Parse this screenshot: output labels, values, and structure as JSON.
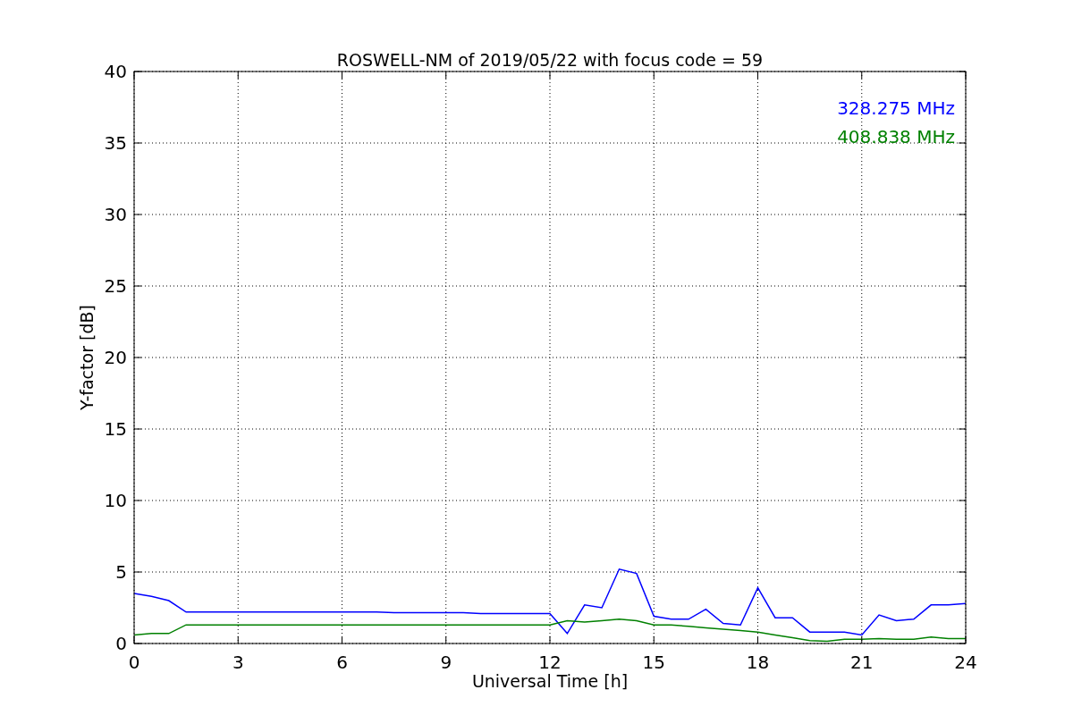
{
  "chart_data": {
    "type": "line",
    "title": "ROSWELL-NM of 2019/05/22 with focus code = 59",
    "xlabel": "Universal Time [h]",
    "ylabel": "Y-factor [dB]",
    "x": [
      0,
      0.5,
      1,
      1.5,
      2,
      2.5,
      3,
      3.5,
      4,
      4.5,
      5,
      5.5,
      6,
      6.5,
      7,
      7.5,
      8,
      8.5,
      9,
      9.5,
      10,
      10.5,
      11,
      11.5,
      12,
      12.5,
      13,
      13.5,
      14,
      14.5,
      15,
      15.5,
      16,
      16.5,
      17,
      17.5,
      18,
      18.5,
      19,
      19.5,
      20,
      20.5,
      21,
      21.5,
      22,
      22.5,
      23,
      23.5,
      24
    ],
    "series": [
      {
        "name": "328.275 MHz",
        "color": "#0000ff",
        "values": [
          3.5,
          3.3,
          3.0,
          2.2,
          2.2,
          2.2,
          2.2,
          2.2,
          2.2,
          2.2,
          2.2,
          2.2,
          2.2,
          2.2,
          2.2,
          2.15,
          2.15,
          2.15,
          2.15,
          2.15,
          2.1,
          2.1,
          2.1,
          2.1,
          2.1,
          0.7,
          2.7,
          2.5,
          5.2,
          4.9,
          1.9,
          1.7,
          1.7,
          2.4,
          1.4,
          1.3,
          3.9,
          1.8,
          1.8,
          0.8,
          0.8,
          0.8,
          0.6,
          2.0,
          1.6,
          1.7,
          2.7,
          2.7,
          2.8
        ]
      },
      {
        "name": "408.838 MHz",
        "color": "#008000",
        "values": [
          0.6,
          0.7,
          0.7,
          1.3,
          1.3,
          1.3,
          1.3,
          1.3,
          1.3,
          1.3,
          1.3,
          1.3,
          1.3,
          1.3,
          1.3,
          1.3,
          1.3,
          1.3,
          1.3,
          1.3,
          1.3,
          1.3,
          1.3,
          1.3,
          1.3,
          1.6,
          1.5,
          1.6,
          1.7,
          1.6,
          1.3,
          1.3,
          1.2,
          1.1,
          1.0,
          0.9,
          0.8,
          0.6,
          0.4,
          0.2,
          0.15,
          0.3,
          0.3,
          0.35,
          0.3,
          0.3,
          0.45,
          0.35,
          0.35
        ]
      }
    ],
    "xlim": [
      0,
      24
    ],
    "ylim": [
      0,
      40
    ],
    "xticks": [
      0,
      3,
      6,
      9,
      12,
      15,
      18,
      21,
      24
    ],
    "yticks": [
      0,
      5,
      10,
      15,
      20,
      25,
      30,
      35,
      40
    ],
    "grid": true
  }
}
